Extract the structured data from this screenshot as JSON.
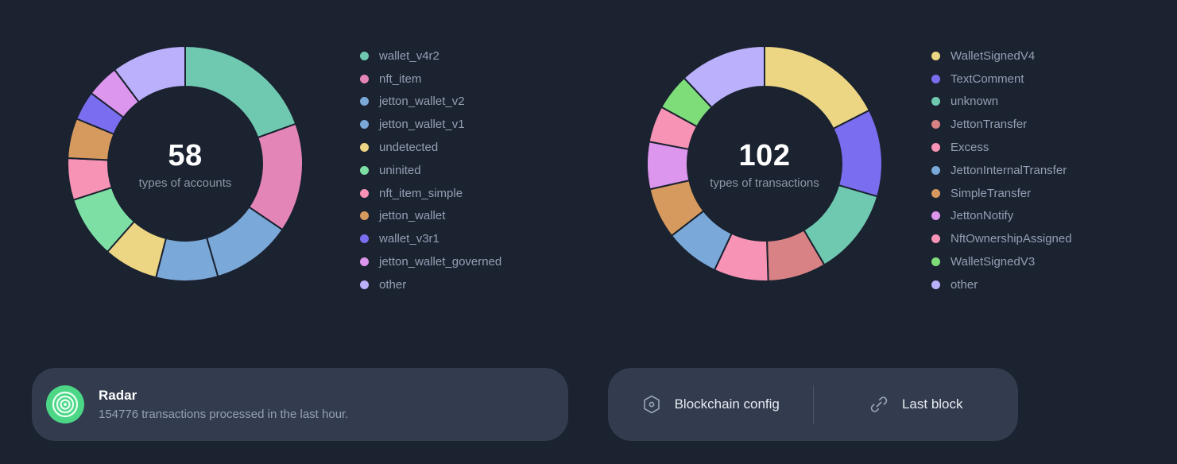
{
  "colors": {
    "page_background": "#1b2230",
    "card_background": "#333c4e",
    "legend_text": "#93a0b4",
    "center_number": "#ffffff",
    "center_caption": "#8d97a8",
    "radar_accent": "#4cd787",
    "divider": "#4b556a"
  },
  "charts": [
    {
      "center_total": "58",
      "center_caption": "types of accounts",
      "legend": [
        {
          "label": "wallet_v4r2",
          "color": "#6fc9b0"
        },
        {
          "label": "nft_item",
          "color": "#e485b8"
        },
        {
          "label": "jetton_wallet_v2",
          "color": "#7aa8d8"
        },
        {
          "label": "jetton_wallet_v1",
          "color": "#7aa8d8"
        },
        {
          "label": "undetected",
          "color": "#ecd684"
        },
        {
          "label": "uninited",
          "color": "#7edfa4"
        },
        {
          "label": "nft_item_simple",
          "color": "#f793b4"
        },
        {
          "label": "jetton_wallet",
          "color": "#d79a5e"
        },
        {
          "label": "wallet_v3r1",
          "color": "#7a6ef0"
        },
        {
          "label": "jetton_wallet_governed",
          "color": "#dd96ee"
        },
        {
          "label": "other",
          "color": "#bbb0fb"
        }
      ]
    },
    {
      "center_total": "102",
      "center_caption": "types of transactions",
      "legend": [
        {
          "label": "WalletSignedV4",
          "color": "#ecd684"
        },
        {
          "label": "TextComment",
          "color": "#7a6ef0"
        },
        {
          "label": "unknown",
          "color": "#6fc9b0"
        },
        {
          "label": "JettonTransfer",
          "color": "#d98285"
        },
        {
          "label": "Excess",
          "color": "#f793b4"
        },
        {
          "label": "JettonInternalTransfer",
          "color": "#7aa8d8"
        },
        {
          "label": "SimpleTransfer",
          "color": "#d79a5e"
        },
        {
          "label": "JettonNotify",
          "color": "#dd96ee"
        },
        {
          "label": "NftOwnershipAssigned",
          "color": "#f793b4"
        },
        {
          "label": "WalletSignedV3",
          "color": "#7edd79"
        },
        {
          "label": "other",
          "color": "#bbb0fb"
        }
      ]
    }
  ],
  "chart_data": [
    {
      "type": "pie",
      "title": "types of accounts",
      "total": 58,
      "legend_position": "right",
      "categories": [
        "wallet_v4r2",
        "nft_item",
        "jetton_wallet_v2",
        "jetton_wallet_v1",
        "undetected",
        "uninited",
        "nft_item_simple",
        "jetton_wallet",
        "wallet_v3r1",
        "jetton_wallet_governed",
        "other"
      ],
      "values": [
        78,
        60,
        44,
        34,
        30,
        34,
        23,
        22,
        16,
        18,
        41
      ],
      "value_unit": "degrees of arc",
      "colors": [
        "#6fc9b0",
        "#e485b8",
        "#7aa8d8",
        "#7aa8d8",
        "#ecd684",
        "#7edfa4",
        "#f793b4",
        "#d79a5e",
        "#7a6ef0",
        "#dd96ee",
        "#bbb0fb"
      ]
    },
    {
      "type": "pie",
      "title": "types of transactions",
      "total": 102,
      "legend_position": "right",
      "categories": [
        "WalletSignedV4",
        "TextComment",
        "unknown",
        "JettonTransfer",
        "Excess",
        "JettonInternalTransfer",
        "SimpleTransfer",
        "JettonNotify",
        "NftOwnershipAssigned",
        "WalletSignedV3",
        "other"
      ],
      "values": [
        70,
        48,
        48,
        32,
        30,
        30,
        28,
        26,
        20,
        20,
        48
      ],
      "value_unit": "degrees of arc",
      "colors": [
        "#ecd684",
        "#7a6ef0",
        "#6fc9b0",
        "#d98285",
        "#f793b4",
        "#7aa8d8",
        "#d79a5e",
        "#dd96ee",
        "#f793b4",
        "#7edd79",
        "#bbb0fb"
      ]
    }
  ],
  "radar_card": {
    "title": "Radar",
    "subtitle": "154776 transactions processed in the last hour.",
    "icon": "radar-icon"
  },
  "links_card": {
    "blockchain_config": {
      "label": "Blockchain config",
      "icon": "hexagon-dot-icon"
    },
    "last_block": {
      "label": "Last block",
      "icon": "link-icon"
    }
  }
}
